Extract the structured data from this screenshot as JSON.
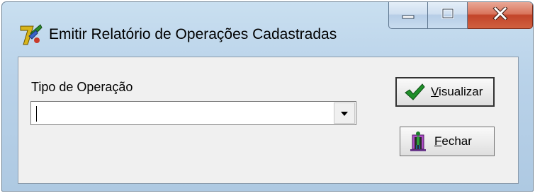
{
  "window": {
    "title": "Emitir Relatório de Operações Cadastradas",
    "app_icon": "delphi-app-icon",
    "caption_buttons": [
      "minimize-icon",
      "maximize-icon",
      "close-icon"
    ]
  },
  "form": {
    "operation_type_label": "Tipo de Operação",
    "operation_type_value": ""
  },
  "buttons": {
    "visualizar": {
      "accel": "V",
      "rest": "isualizar",
      "icon": "checkmark-icon"
    },
    "fechar": {
      "accel": "F",
      "rest": "echar",
      "icon": "door-exit-icon"
    }
  },
  "colors": {
    "close_button": "#c94a2c",
    "check_green": "#1f8f2a",
    "client_bg": "#f0f0f0",
    "frame": "#b9d2e9"
  }
}
